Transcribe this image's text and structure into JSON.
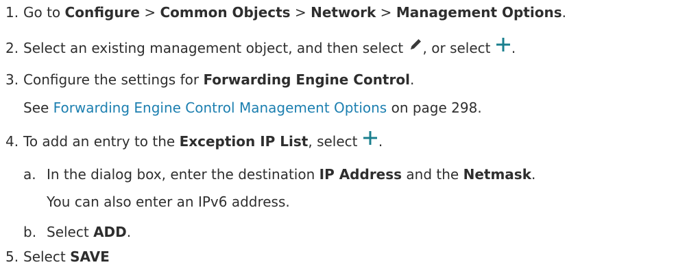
{
  "steps": {
    "s1": {
      "num": "1.",
      "t1": "Go to ",
      "b1": "Configure",
      "sep1": " > ",
      "b2": "Common Objects",
      "sep2": " > ",
      "b3": "Network",
      "sep3": " > ",
      "b4": "Management Options",
      "end": "."
    },
    "s2": {
      "num": "2.",
      "t1": "Select an existing management object, and then select ",
      "t2": ", or select ",
      "end": "."
    },
    "s3": {
      "num": "3.",
      "t1": "Configure the settings for ",
      "b1": "Forwarding Engine Control",
      "end": ".",
      "see_pre": "See ",
      "see_link": "Forwarding Engine Control Management Options",
      "see_post": " on page 298."
    },
    "s4": {
      "num": "4.",
      "t1": "To add an entry to the ",
      "b1": "Exception IP List",
      "t2": ", select ",
      "end": ".",
      "sub_a": {
        "label": "a.",
        "t1": "In the dialog box, enter the destination ",
        "b1": "IP Address",
        "t2": " and the ",
        "b2": "Netmask",
        "end": ".",
        "note": "You can also enter an IPv6 address."
      },
      "sub_b": {
        "label": "b.",
        "t1": "Select ",
        "b1": "ADD",
        "end": "."
      }
    },
    "s5": {
      "num": "5.",
      "t1": "Select ",
      "b1": "SAVE"
    }
  },
  "icons": {
    "edit": "pencil-icon",
    "add": "plus-icon",
    "accent_color": "#1a7f8e"
  },
  "colors": {
    "text": "#2e2e2e",
    "link": "#1c7fb0"
  }
}
